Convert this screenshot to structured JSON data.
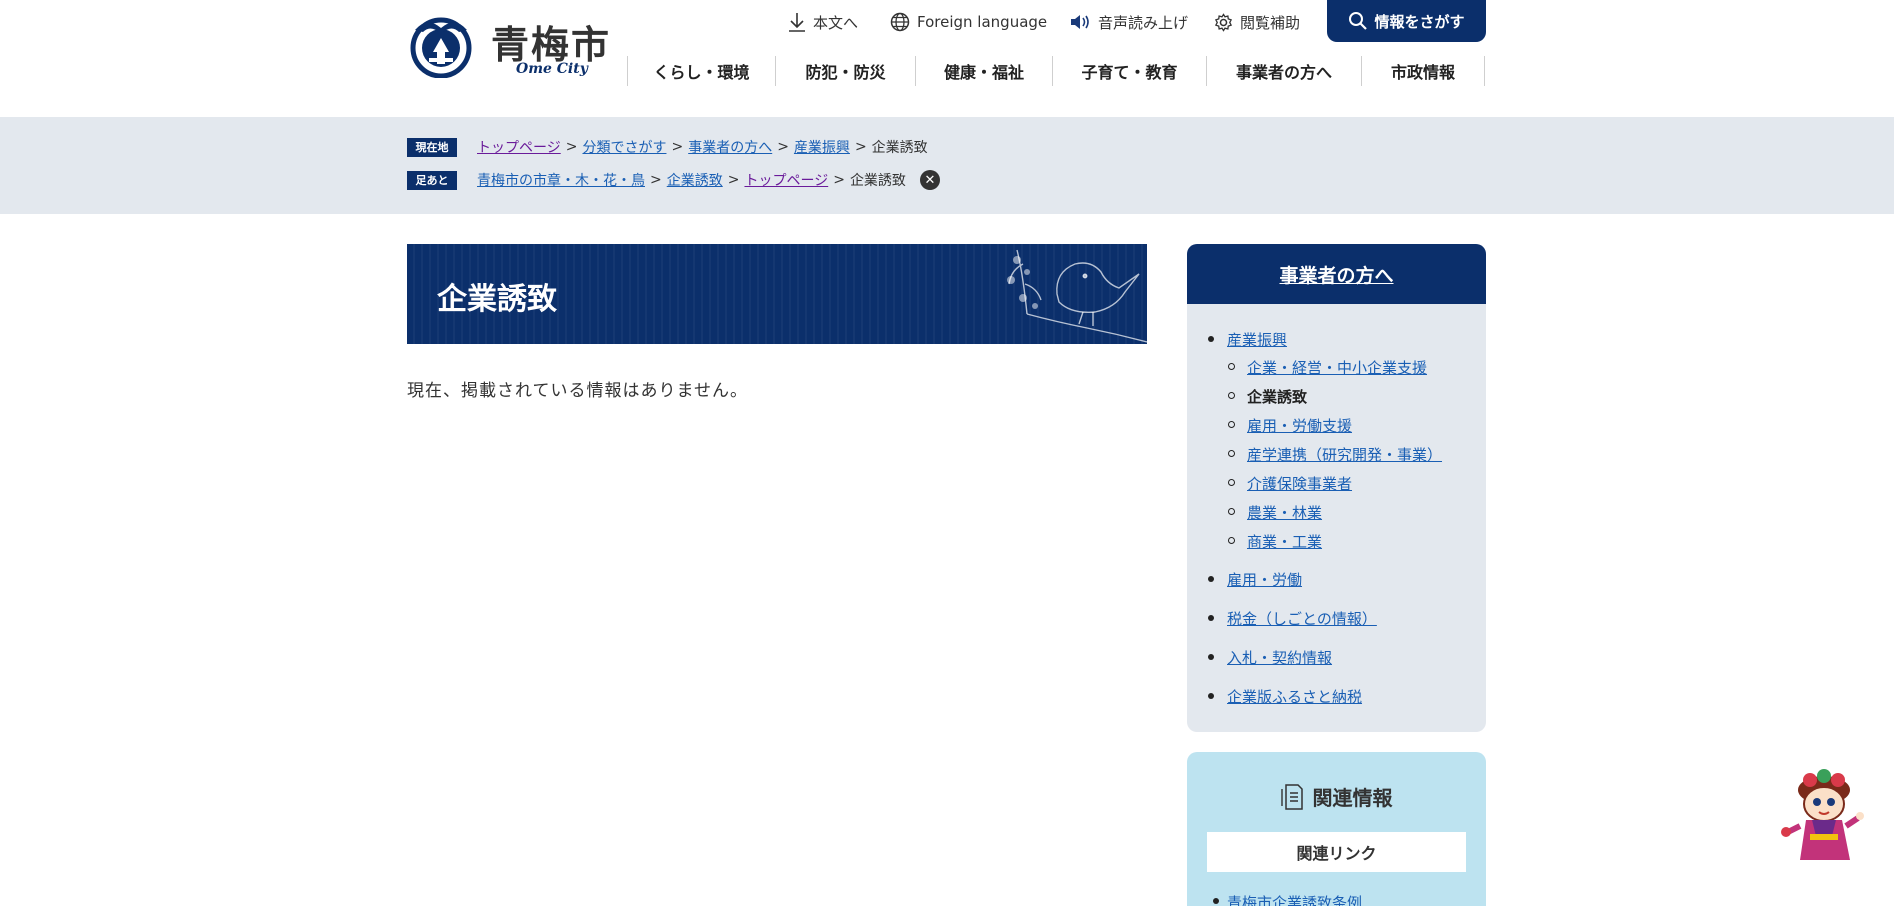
{
  "header": {
    "logo_name": "青梅市",
    "logo_sub": "Ome City",
    "utility": {
      "skip": "本文へ",
      "foreign": "Foreign language",
      "read_aloud": "音声読み上げ",
      "browse_assist": "閲覧補助"
    },
    "search_button": "情報をさがす",
    "nav": [
      "くらし・環境",
      "防犯・防災",
      "健康・福祉",
      "子育て・教育",
      "事業者の方へ",
      "市政情報"
    ]
  },
  "breadcrumb": {
    "current_tag": "現在地",
    "current_path": [
      "トップページ",
      "分類でさがす",
      "事業者の方へ",
      "産業振興"
    ],
    "current_page": "企業誘致",
    "footprint_tag": "足あと",
    "footprint_path": [
      "青梅市の市章・木・花・鳥",
      "企業誘致",
      "トップページ"
    ],
    "footprint_page": "企業誘致",
    "separator": ">"
  },
  "main": {
    "title": "企業誘致",
    "no_info": "現在、掲載されている情報はありません。"
  },
  "sidebar": {
    "heading": "事業者の方へ",
    "items": [
      {
        "label": "産業振興"
      },
      {
        "label": "企業・経営・中小企業支援"
      },
      {
        "label": "企業誘致"
      },
      {
        "label": "雇用・労働支援"
      },
      {
        "label": "産学連携（研究開発・事業）"
      },
      {
        "label": "介護保険事業者"
      },
      {
        "label": "農業・林業"
      },
      {
        "label": "商業・工業"
      },
      {
        "label": "雇用・労働"
      },
      {
        "label": "税金（しごとの情報）"
      },
      {
        "label": "入札・契約情報"
      },
      {
        "label": "企業版ふるさと納税"
      }
    ]
  },
  "related": {
    "heading": "関連情報",
    "sub_heading": "関連リンク",
    "link": "青梅市企業誘致条例"
  },
  "colors": {
    "navy": "#0b2f6b",
    "crumb_bg": "#e3e8ee",
    "related_bg": "#bde3f0",
    "link": "#1a5fb4",
    "visited": "#6a1b9a"
  }
}
